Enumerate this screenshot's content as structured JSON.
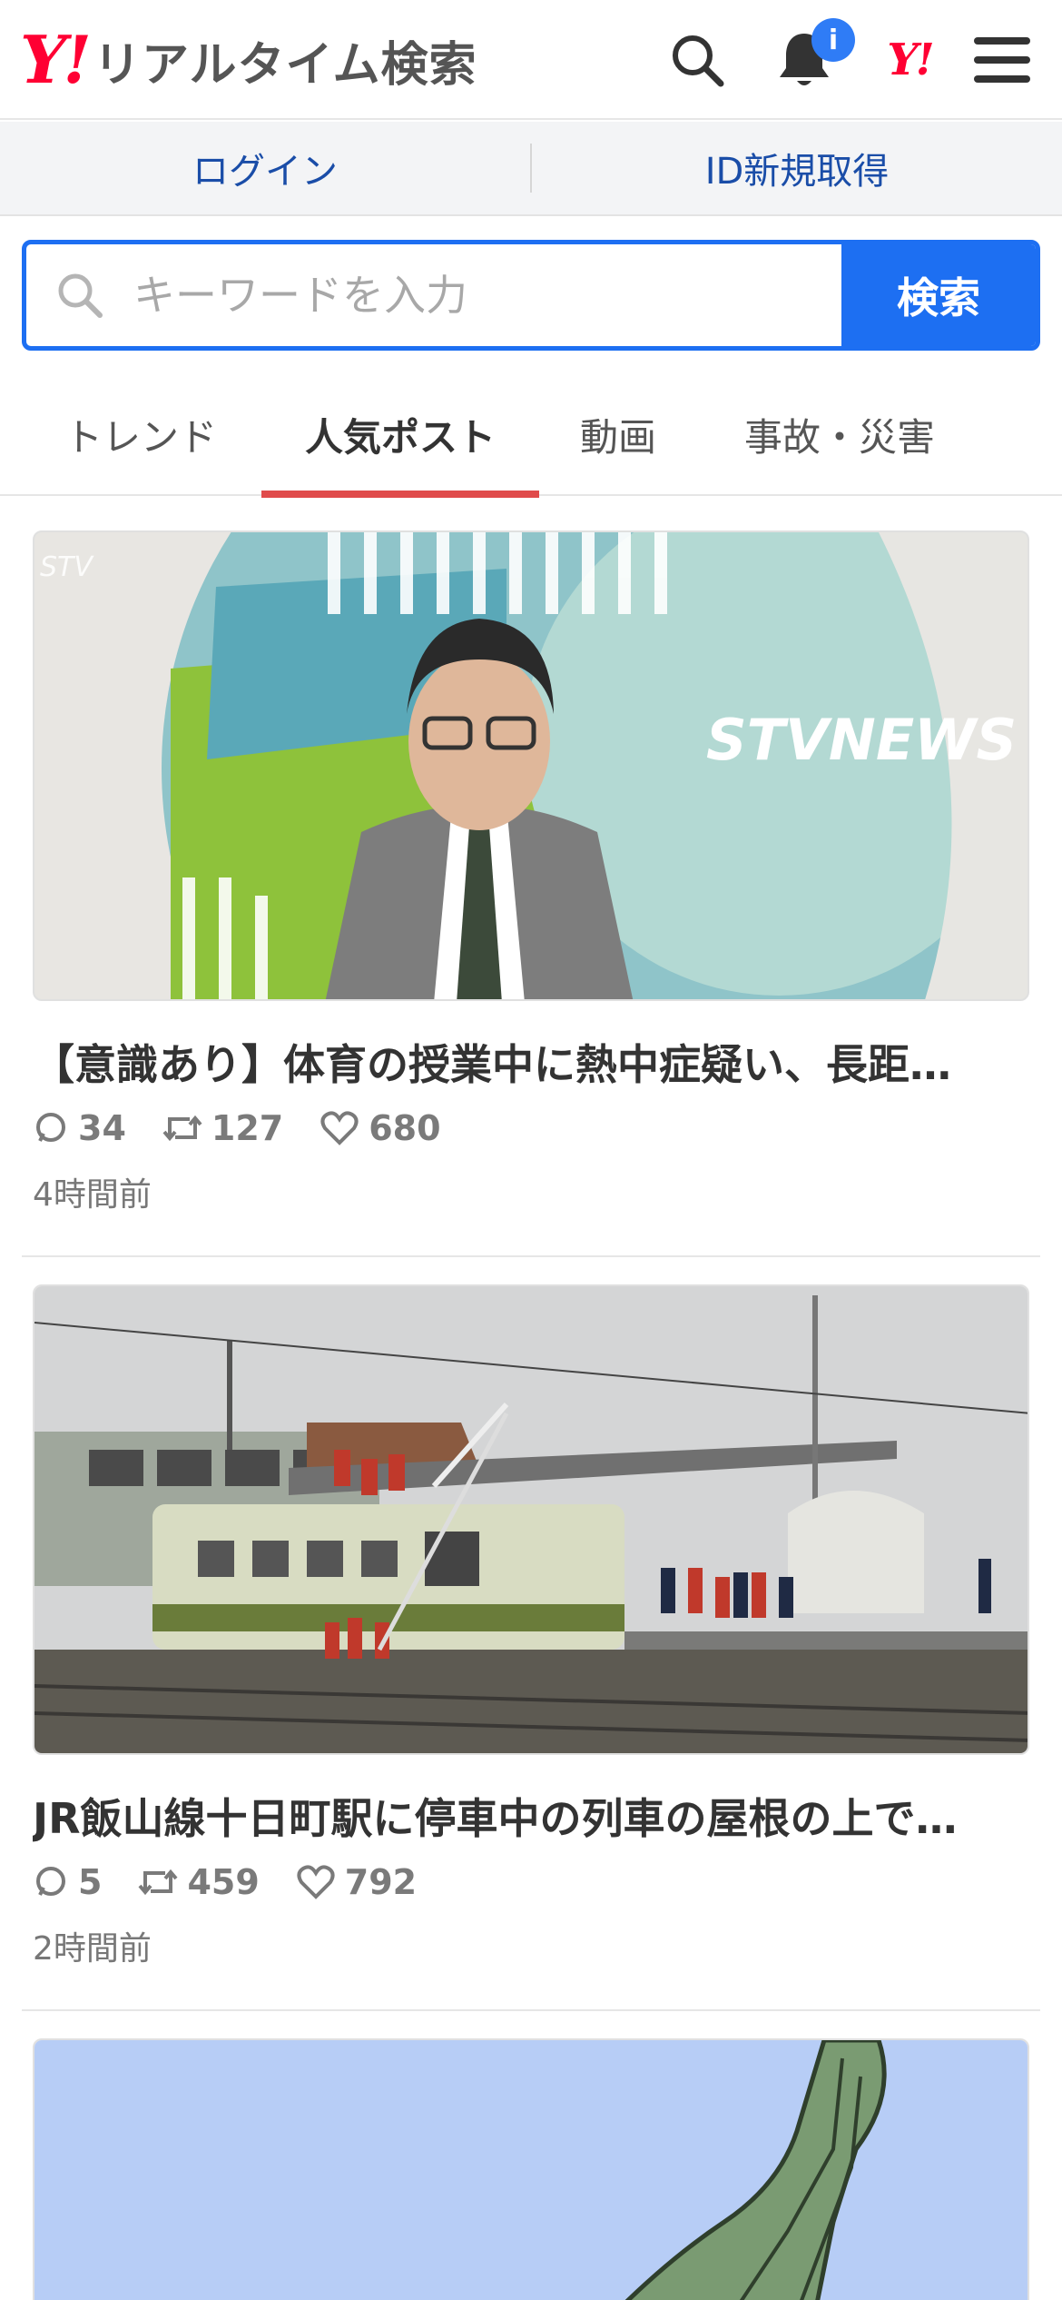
{
  "header": {
    "logo": "Y!",
    "title": "リアルタイム検索",
    "notification_badge": "i",
    "yahoo_logo": "Y!"
  },
  "login_bar": {
    "login_label": "ログイン",
    "signup_label": "ID新規取得"
  },
  "search": {
    "placeholder": "キーワードを入力",
    "value": "",
    "button_label": "検索"
  },
  "tabs": [
    {
      "label": "トレンド",
      "active": false
    },
    {
      "label": "人気ポスト",
      "active": true
    },
    {
      "label": "動画",
      "active": false
    },
    {
      "label": "事故・災害",
      "active": false
    }
  ],
  "posts": [
    {
      "image_overlay_text": "STVNEWS",
      "image_corner_text": "STV",
      "title": "【意識あり】体育の授業中に熱中症疑い、長距…",
      "replies": "34",
      "reposts": "127",
      "likes": "680",
      "time": "4時間前"
    },
    {
      "title": "JR飯山線十日町駅に停車中の列車の屋根の上で…",
      "replies": "5",
      "reposts": "459",
      "likes": "792",
      "time": "2時間前"
    }
  ],
  "colors": {
    "accent": "#1d6ff2",
    "brand_red": "#ff0033",
    "tab_indicator": "#e04b4b",
    "link_blue": "#1a4da8"
  }
}
